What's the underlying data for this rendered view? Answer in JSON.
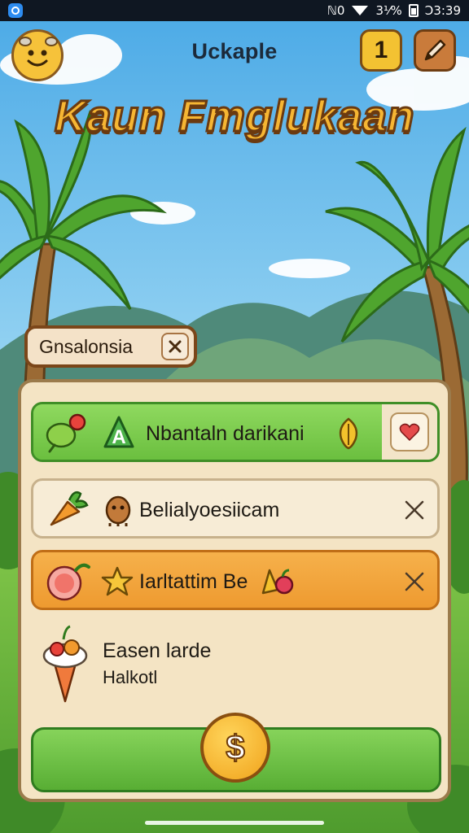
{
  "status_bar": {
    "signal_text": "ℕ0",
    "battery_text": "3⅟%",
    "time": "Ɔ3:39"
  },
  "header": {
    "screen_title": "Uckaple",
    "counter_value": "1",
    "avatar_icon": "smiley-face-icon",
    "tool_icon": "pencil-icon"
  },
  "game_title": "Kaun Fmglukaan",
  "filter_chip": {
    "label": "Gnsalonsia",
    "close_icon": "close-icon"
  },
  "list": {
    "rows": [
      {
        "label": "Nbantaln darikani",
        "icons": [
          "vegetables-icon",
          "letter-a-badge-icon",
          "leaf-emblem-icon",
          "heart-icon"
        ]
      },
      {
        "label": "Belialyoesiicam",
        "icons": [
          "carrot-bundle-icon",
          "creature-icon",
          "close-icon"
        ]
      },
      {
        "label": "Iarltattim Be",
        "icons": [
          "fruit-slice-icon",
          "star-icon",
          "fruit-bundle-icon",
          "close-icon"
        ]
      }
    ],
    "featured": {
      "title": "Easen larde",
      "subtitle": "Halkotl",
      "icon": "ice-cream-icon"
    }
  },
  "buy_button": {
    "icon": "dollar-coin-icon",
    "glyph": "$"
  },
  "colors": {
    "sky": "#7cc7ef",
    "title_fill": "#f6b633",
    "title_outline": "#6b3a10",
    "row_green": "#79c94c",
    "row_orange": "#f0a237",
    "panel": "#f4e4c4",
    "buy_green": "#58ae34"
  }
}
